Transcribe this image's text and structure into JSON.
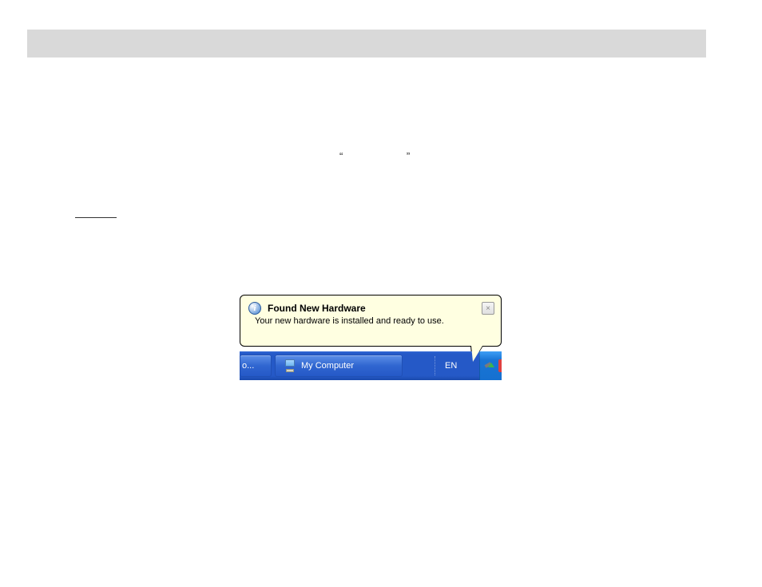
{
  "page": {
    "quote_left": "“",
    "quote_right": "”"
  },
  "balloon": {
    "title": "Found New Hardware",
    "message": "Your new hardware is installed and ready to use.",
    "info_symbol": "i",
    "close_symbol": "×"
  },
  "taskbar": {
    "partial_item_label": "o...",
    "items": [
      {
        "label": "My Computer"
      }
    ],
    "language": "EN"
  }
}
